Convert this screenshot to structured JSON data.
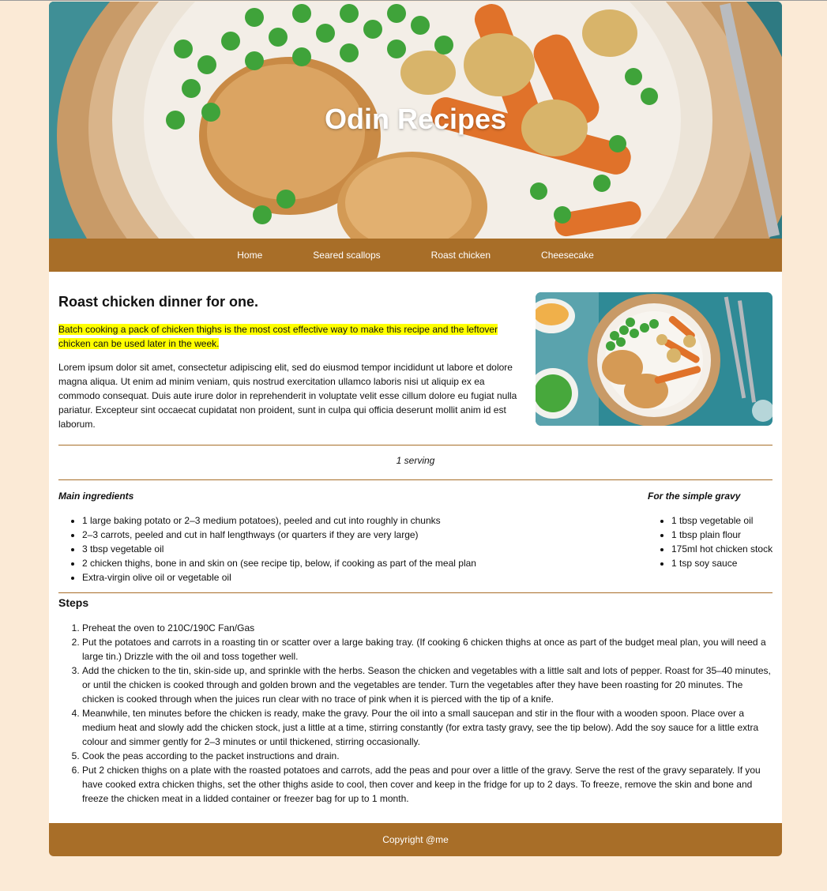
{
  "header": {
    "title": "Odin Recipes"
  },
  "nav": {
    "items": [
      {
        "label": "Home"
      },
      {
        "label": "Seared scallops"
      },
      {
        "label": "Roast chicken"
      },
      {
        "label": "Cheesecake"
      }
    ]
  },
  "recipe": {
    "title": "Roast chicken dinner for one.",
    "highlight": "Batch cooking a pack of chicken thighs is the most cost effective way to make this recipe and the leftover chicken can be used later in the week.",
    "description": "Lorem ipsum dolor sit amet, consectetur adipiscing elit, sed do eiusmod tempor incididunt ut labore et dolore magna aliqua. Ut enim ad minim veniam, quis nostrud exercitation ullamco laboris nisi ut aliquip ex ea commodo consequat. Duis aute irure dolor in reprehenderit in voluptate velit esse cillum dolore eu fugiat nulla pariatur. Excepteur sint occaecat cupidatat non proident, sunt in culpa qui officia deserunt mollit anim id est laborum.",
    "serving": "1 serving",
    "main_heading": "Main ingredients",
    "main_ingredients": [
      "1 large baking potato or 2–3 medium potatoes), peeled and cut into roughly in chunks",
      "2–3 carrots, peeled and cut in half lengthways (or quarters if they are very large)",
      "3 tbsp vegetable oil",
      "2 chicken thighs, bone in and skin on (see recipe tip, below, if cooking as part of the meal plan",
      "Extra-virgin olive oil or vegetable oil"
    ],
    "gravy_heading": "For the simple gravy",
    "gravy_ingredients": [
      "1 tbsp vegetable oil",
      "1 tbsp plain flour",
      "175ml hot chicken stock",
      "1 tsp soy sauce"
    ],
    "steps_heading": "Steps",
    "steps": [
      "Preheat the oven to 210C/190C Fan/Gas",
      "Put the potatoes and carrots in a roasting tin or scatter over a large baking tray. (If cooking 6 chicken thighs at once as part of the budget meal plan, you will need a large tin.) Drizzle with the oil and toss together well.",
      "Add the chicken to the tin, skin-side up, and sprinkle with the herbs. Season the chicken and vegetables with a little salt and lots of pepper. Roast for 35–40 minutes, or until the chicken is cooked through and golden brown and the vegetables are tender. Turn the vegetables after they have been roasting for 20 minutes. The chicken is cooked through when the juices run clear with no trace of pink when it is pierced with the tip of a knife.",
      "Meanwhile, ten minutes before the chicken is ready, make the gravy. Pour the oil into a small saucepan and stir in the flour with a wooden spoon. Place over a medium heat and slowly add the chicken stock, just a little at a time, stirring constantly (for extra tasty gravy, see the tip below). Add the soy sauce for a little extra colour and simmer gently for 2–3 minutes or until thickened, stirring occasionally.",
      "Cook the peas according to the packet instructions and drain.",
      "Put 2 chicken thighs on a plate with the roasted potatoes and carrots, add the peas and pour over a little of the gravy. Serve the rest of the gravy separately. If you have cooked extra chicken thighs, set the other thighs aside to cool, then cover and keep in the fridge for up to 2 days. To freeze, remove the skin and bone and freeze the chicken meat in a lidded container or freezer bag for up to 1 month."
    ]
  },
  "footer": {
    "text": "Copyright @me"
  },
  "colors": {
    "page_background": "#fbead6",
    "brand_brown": "#a86e28",
    "highlight": "#ffff00"
  }
}
